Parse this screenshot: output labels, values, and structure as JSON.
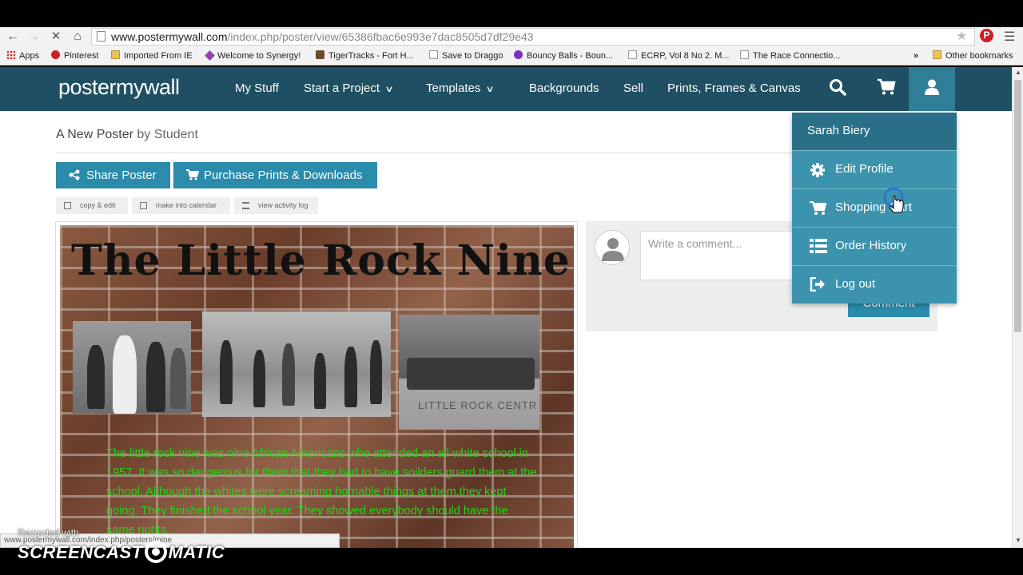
{
  "browser": {
    "url_domain": "www.postermywall.com",
    "url_path": "/index.php/poster/view/65386fbac6e993e7dac8505d7df29e43",
    "bookmarks": [
      {
        "label": "Apps",
        "icon": "apps-grid-icon"
      },
      {
        "label": "Pinterest",
        "icon": "pinterest-icon"
      },
      {
        "label": "Imported From IE",
        "icon": "folder-icon"
      },
      {
        "label": "Welcome to Synergy!",
        "icon": "synergy-icon"
      },
      {
        "label": "TigerTracks - Fort H...",
        "icon": "tiger-icon"
      },
      {
        "label": "Save to Draggo",
        "icon": "page-icon"
      },
      {
        "label": "Bouncy Balls - Boun...",
        "icon": "ball-icon"
      },
      {
        "label": "ECRP, Vol 8 No 2. M...",
        "icon": "page-icon"
      },
      {
        "label": "The Race Connectio...",
        "icon": "page-icon"
      }
    ],
    "more_bookmarks": "»",
    "other_bookmarks": "Other bookmarks",
    "status_url": "www.postermywall.com/index.php/posters/mine"
  },
  "site": {
    "logo": "postermywall",
    "nav": [
      {
        "label": "My Stuff",
        "dropdown": false
      },
      {
        "label": "Start a Project",
        "dropdown": true
      },
      {
        "label": "Templates",
        "dropdown": true
      },
      {
        "label": "Backgrounds",
        "dropdown": false
      },
      {
        "label": "Sell",
        "dropdown": false
      },
      {
        "label": "Prints, Frames & Canvas",
        "dropdown": false
      }
    ],
    "header_color": "#1f4f62",
    "accent_color": "#2a8bab"
  },
  "page": {
    "title": "A New Poster",
    "by_text": "by Student",
    "share_label": "Share Poster",
    "purchase_label": "Purchase Prints & Downloads",
    "small_buttons": [
      "copy & edit",
      "make into calendar",
      "view activity log"
    ]
  },
  "poster": {
    "title": "The Little Rock Nine",
    "photo3_caption": "LITTLE ROCK CENTR",
    "body_text": "The little rock nine was nine African Americans who attended an all white school in 1957. It was so dangerous for them that they had to have soilders guard them at the school. Although the whites were screaming horriable things at them,they kept going. They finished the school year. They showed everybody should have the same rights.",
    "text_color": "#2bd11b"
  },
  "comment": {
    "placeholder": "Write a comment...",
    "button_label": "Comment"
  },
  "user_menu": {
    "name": "Sarah Biery",
    "items": [
      {
        "label": "Edit Profile",
        "icon": "gear-icon"
      },
      {
        "label": "Shopping Cart",
        "icon": "cart-icon"
      },
      {
        "label": "Order History",
        "icon": "list-icon"
      },
      {
        "label": "Log out",
        "icon": "logout-icon"
      }
    ]
  },
  "watermark": {
    "line1": "Recorded with",
    "line2a": "SCREENCAST",
    "line2b": "MATIC"
  }
}
